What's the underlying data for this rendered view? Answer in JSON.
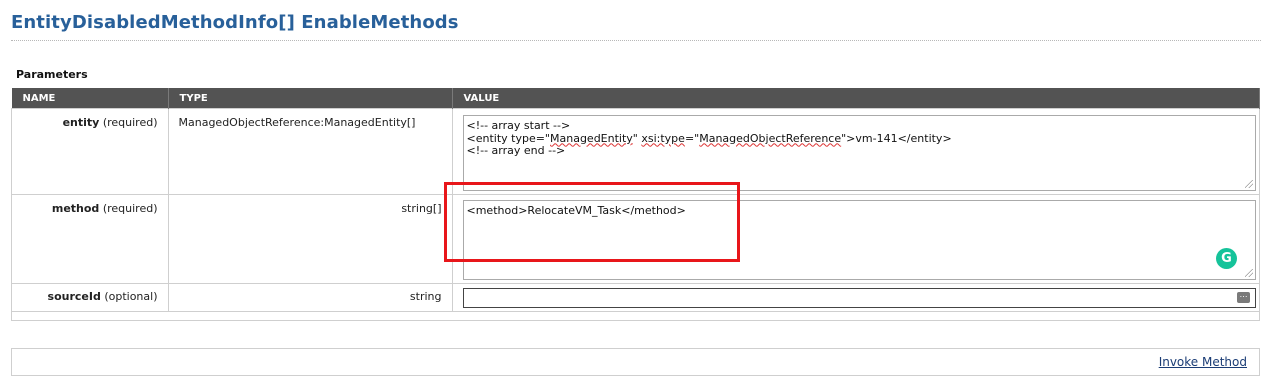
{
  "header": {
    "title": "EntityDisabledMethodInfo[] EnableMethods"
  },
  "parameters": {
    "section_label": "Parameters",
    "columns": [
      "NAME",
      "TYPE",
      "VALUE"
    ],
    "rows": [
      {
        "name": "entity",
        "qualifier": "(required)",
        "type": "ManagedObjectReference:ManagedEntity[]",
        "value_lines": {
          "line1": "<!-- array start -->",
          "line2_prefix": "<entity type=\"",
          "line2_type": "ManagedEntity",
          "line2_mid1": "\" ",
          "line2_xsi": "xsi:type",
          "line2_mid2": "=\"",
          "line2_ref": "ManagedObjectReference",
          "line2_suffix": "\">vm-141</entity>",
          "line3": "<!-- array end -->"
        }
      },
      {
        "name": "method",
        "qualifier": "(required)",
        "type": "string[]",
        "value": "<method>RelocateVM_Task</method>",
        "assistant_badge": "G"
      },
      {
        "name": "sourceId",
        "qualifier": "(optional)",
        "type": "string",
        "value": "",
        "input_icon": "keyboard-icon"
      }
    ]
  },
  "footer": {
    "invoke_label": "Invoke Method"
  },
  "colors": {
    "title": "#28609a",
    "header_bg": "#535353",
    "highlight": "#e8161a",
    "grammarly": "#15c39a",
    "link": "#1a3c75"
  }
}
